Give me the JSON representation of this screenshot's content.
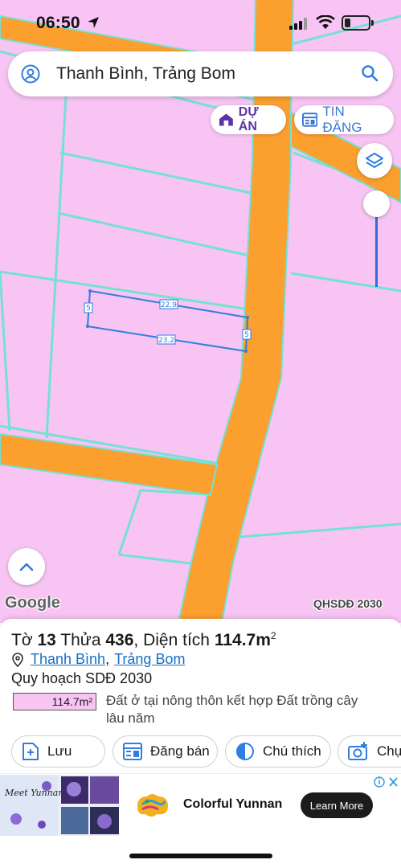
{
  "status_bar": {
    "time": "06:50"
  },
  "search": {
    "query": "Thanh Bình, Trảng Bom"
  },
  "chips": {
    "du_an": "DỰ ÁN",
    "tin_dang": "TIN ĐĂNG"
  },
  "map": {
    "parcel_labels": {
      "top": "22.9",
      "bottom": "23.2",
      "left": "5",
      "right": "5"
    },
    "attribution": "Google",
    "layer_label": "QHSDĐ 2030",
    "colors": {
      "land": "#f7c4f3",
      "road": "#fb9f2f",
      "boundary": "#74e1d3",
      "parcel_outline": "#2f7ee0"
    }
  },
  "parcel": {
    "to_label": "Tờ",
    "to_number": "13",
    "thua_label": "Thửa",
    "thua_number": "436",
    "dien_tich_label": "Diện tích",
    "area_value": "114.7m",
    "area_sup": "2",
    "commune": "Thanh Bình",
    "district": "Trảng Bom",
    "planning_title": "Quy hoạch SDĐ 2030",
    "legend_area": "114.7m²",
    "land_use": "Đất ở tại nông thôn kết hợp Đất trồng cây lâu năm"
  },
  "actions": {
    "luu": "Lưu",
    "dang_ban": "Đăng bán",
    "chu_thich": "Chú thích",
    "chup": "Chụp"
  },
  "ad": {
    "thumb_text": "Meet Yunnan",
    "brand": "Colorful Yunnan",
    "cta": "Learn More"
  }
}
